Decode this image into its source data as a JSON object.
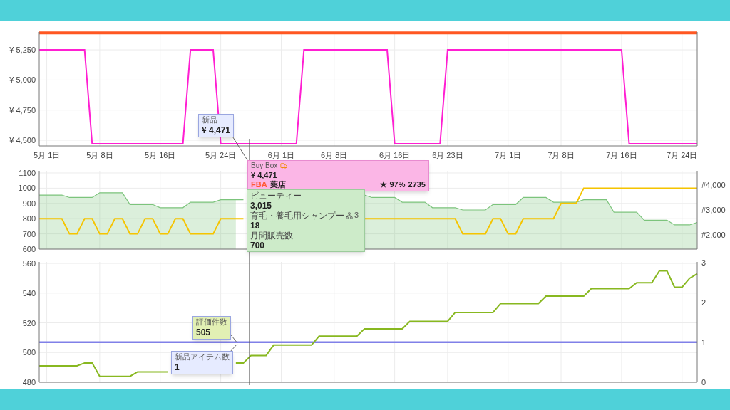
{
  "charts": [
    {
      "chart_data": {
        "type": "line",
        "grid": true,
        "ylim": [
          4453,
          5398
        ],
        "categories": [
          null,
          "5月 1日",
          null,
          null,
          null,
          null,
          null,
          null,
          "5月 8日",
          null,
          null,
          null,
          null,
          null,
          null,
          null,
          "5月 16日",
          null,
          null,
          null,
          null,
          null,
          null,
          null,
          "5月 24日",
          null,
          null,
          null,
          null,
          null,
          null,
          null,
          "6月 1日",
          null,
          null,
          null,
          null,
          null,
          null,
          "6月 8日",
          null,
          null,
          null,
          null,
          null,
          null,
          null,
          "6月 16日",
          null,
          null,
          null,
          null,
          null,
          null,
          "6月 23日",
          null,
          null,
          null,
          null,
          null,
          null,
          null,
          "7月 1日",
          null,
          null,
          null,
          null,
          null,
          null,
          "7月 8日",
          null,
          null,
          null,
          null,
          null,
          null,
          null,
          "7月 16日",
          null,
          null,
          null,
          null,
          null,
          null,
          null,
          "7月 24日",
          null,
          null
        ],
        "yticks": [
          {
            "value": 4500,
            "label": "¥ 4,500"
          },
          {
            "value": 4750,
            "label": "¥ 4,750"
          },
          {
            "value": 5000,
            "label": "¥ 5,000"
          },
          {
            "value": 5250,
            "label": "¥ 5,250"
          }
        ],
        "series": [
          {
            "color": "#ff5722",
            "values": [
              5390,
              5390,
              5390,
              5390,
              5390,
              5390,
              5390,
              5390,
              5390,
              5390,
              5390,
              5390,
              5390,
              5390,
              5390,
              5390,
              5390,
              5390,
              5390,
              5390,
              5390,
              5390,
              5390,
              5390,
              5390,
              5390,
              5390,
              5390,
              5390,
              5390,
              5390,
              5390,
              5390,
              5390,
              5390,
              5390,
              5390,
              5390,
              5390,
              5390,
              5390,
              5390,
              5390,
              5390,
              5390,
              5390,
              5390,
              5390,
              5390,
              5390,
              5390,
              5390,
              5390,
              5390,
              5390,
              5390,
              5390,
              5390,
              5390,
              5390,
              5390,
              5390,
              5390,
              5390,
              5390,
              5390,
              5390,
              5390,
              5390,
              5390,
              5390,
              5390,
              5390,
              5390,
              5390,
              5390,
              5390,
              5390,
              5390,
              5390,
              5390,
              5390,
              5390,
              5390,
              5390,
              5390,
              5390,
              5390
            ]
          },
          {
            "color": "#ff1fd2",
            "values": [
              5250,
              5250,
              5250,
              5250,
              5250,
              5250,
              5250,
              4471,
              4471,
              4471,
              4471,
              4471,
              4471,
              4471,
              4471,
              4471,
              4471,
              4471,
              4471,
              4471,
              5250,
              5250,
              5250,
              5250,
              4471,
              4471,
              4471,
              4471,
              4471,
              4471,
              4471,
              4471,
              4471,
              4471,
              4471,
              5250,
              5250,
              5250,
              5250,
              5250,
              5250,
              5250,
              5250,
              5250,
              5250,
              5250,
              5250,
              4471,
              4471,
              4471,
              4471,
              4471,
              4471,
              4471,
              5250,
              5250,
              5250,
              5250,
              5250,
              5250,
              5250,
              5250,
              5250,
              5250,
              5250,
              5250,
              5250,
              5250,
              5250,
              5250,
              5250,
              5250,
              5250,
              5250,
              5250,
              5250,
              5250,
              5250,
              4471,
              4471,
              4471,
              4471,
              4471,
              4471,
              4471,
              4471,
              4471,
              4471
            ]
          }
        ]
      },
      "tooltips": [
        {
          "kind": "simple",
          "title": "新品",
          "value": "¥ 4,471",
          "color": "#e6ebff"
        },
        {
          "kind": "buybox",
          "title": "Buy Box",
          "value": "¥ 4,471",
          "fulfillment": "FBA",
          "seller": "薬店",
          "rating": "★ 97%",
          "count": "2735",
          "color": "#fbb6e6"
        }
      ]
    },
    {
      "chart_data": {
        "type": "line",
        "grid": true,
        "ylim": [
          600,
          1114
        ],
        "categories": [
          null,
          null,
          null,
          null,
          null,
          null,
          null,
          null,
          null,
          null,
          null,
          null,
          null,
          null,
          null,
          null,
          null,
          null,
          null,
          null,
          null,
          null,
          null,
          null,
          null,
          null,
          null,
          null,
          null,
          null,
          null,
          null,
          null,
          null,
          null,
          null,
          null,
          null,
          null,
          null,
          null,
          null,
          null,
          null,
          null,
          null,
          null,
          null,
          null,
          null,
          null,
          null,
          null,
          null,
          null,
          null,
          null,
          null,
          null,
          null,
          null,
          null,
          null,
          null,
          null,
          null,
          null,
          null,
          null,
          null,
          null,
          null,
          null,
          null,
          null,
          null,
          null,
          null,
          null,
          null,
          null,
          null,
          null,
          null,
          null,
          null,
          null,
          null
        ],
        "yticks": [
          {
            "value": 600,
            "label": "600"
          },
          {
            "value": 700,
            "label": "700"
          },
          {
            "value": 800,
            "label": "800"
          },
          {
            "value": 900,
            "label": "900"
          },
          {
            "value": 1000,
            "label": "1000"
          },
          {
            "value": 1100,
            "label": "1100"
          }
        ],
        "series": [
          {
            "type": "area",
            "color": "#7cc47c",
            "values": [
              955,
              955,
              955,
              955,
              939,
              939,
              939,
              939,
              970,
              970,
              970,
              970,
              893,
              893,
              893,
              893,
              872,
              872,
              872,
              872,
              908,
              908,
              908,
              908,
              924,
              924,
              924,
              null,
              null,
              null,
              null,
              null,
              null,
              null,
              null,
              null,
              null,
              null,
              null,
              null,
              null,
              null,
              null,
              955,
              939,
              939,
              939,
              939,
              908,
              908,
              908,
              908,
              872,
              872,
              872,
              872,
              857,
              857,
              857,
              857,
              893,
              893,
              893,
              893,
              939,
              939,
              939,
              939,
              908,
              908,
              908,
              908,
              924,
              924,
              924,
              924,
              842,
              842,
              842,
              842,
              790,
              790,
              790,
              790,
              759,
              759,
              759,
              775
            ]
          },
          {
            "color": "#f5c400",
            "values": [
              800,
              800,
              800,
              800,
              700,
              700,
              800,
              800,
              700,
              700,
              800,
              800,
              700,
              700,
              800,
              800,
              700,
              700,
              800,
              800,
              700,
              700,
              700,
              700,
              800,
              800,
              800,
              null,
              null,
              null,
              null,
              null,
              null,
              null,
              null,
              null,
              null,
              null,
              null,
              null,
              null,
              null,
              null,
              800,
              800,
              800,
              800,
              800,
              800,
              800,
              800,
              800,
              800,
              800,
              800,
              800,
              700,
              700,
              700,
              700,
              800,
              800,
              700,
              700,
              800,
              800,
              800,
              800,
              800,
              900,
              900,
              900,
              1000,
              1000,
              1000,
              1000,
              1000,
              1000,
              1000,
              1000,
              1000,
              1000,
              1000,
              1000,
              1000,
              1000,
              1000,
              1000
            ]
          }
        ]
      },
      "right_axis_labels": [
        "#4,000",
        "#3,000",
        "#2,000"
      ],
      "tooltips": [
        {
          "kind": "rank",
          "color": "#cdebc9",
          "items": [
            {
              "label": "ビューティー",
              "value": "3,015"
            },
            {
              "label": "育毛・養毛用シャンプー",
              "value": "18",
              "badge": "3"
            },
            {
              "label": "月間販売数",
              "value": "700"
            }
          ]
        }
      ]
    },
    {
      "chart_data": {
        "type": "line",
        "grid": true,
        "ylim": [
          480,
          561
        ],
        "categories": [
          null,
          null,
          null,
          null,
          null,
          null,
          null,
          null,
          null,
          null,
          null,
          null,
          null,
          null,
          null,
          null,
          null,
          null,
          null,
          null,
          null,
          null,
          null,
          null,
          null,
          null,
          null,
          null,
          null,
          null,
          null,
          null,
          null,
          null,
          null,
          null,
          null,
          null,
          null,
          null,
          null,
          null,
          null,
          null,
          null,
          null,
          null,
          null,
          null,
          null,
          null,
          null,
          null,
          null,
          null,
          null,
          null,
          null,
          null,
          null,
          null,
          null,
          null,
          null,
          null,
          null,
          null,
          null,
          null,
          null,
          null,
          null,
          null,
          null,
          null,
          null,
          null,
          null,
          null,
          null,
          null,
          null,
          null,
          null,
          null,
          null,
          null,
          null
        ],
        "yticks": [
          {
            "value": 480,
            "label": "480"
          },
          {
            "value": 500,
            "label": "500"
          },
          {
            "value": 520,
            "label": "520"
          },
          {
            "value": 540,
            "label": "540"
          },
          {
            "value": 560,
            "label": "560"
          }
        ],
        "series": [
          {
            "color": "#8080e8",
            "values": [
              507,
              507,
              507,
              507,
              507,
              507,
              507,
              507,
              507,
              507,
              507,
              507,
              507,
              507,
              507,
              507,
              507,
              507,
              507,
              507,
              507,
              507,
              507,
              507,
              507,
              507,
              507,
              507,
              507,
              507,
              507,
              507,
              507,
              507,
              507,
              507,
              507,
              507,
              507,
              507,
              507,
              507,
              507,
              507,
              507,
              507,
              507,
              507,
              507,
              507,
              507,
              507,
              507,
              507,
              507,
              507,
              507,
              507,
              507,
              507,
              507,
              507,
              507,
              507,
              507,
              507,
              507,
              507,
              507,
              507,
              507,
              507,
              507,
              507,
              507,
              507,
              507,
              507,
              507,
              507,
              507,
              507,
              507,
              507,
              507,
              507,
              507,
              507
            ]
          },
          {
            "color": "#88b820",
            "values": [
              491,
              491,
              491,
              491,
              491,
              491,
              493,
              493,
              484,
              484,
              484,
              484,
              484,
              487,
              487,
              487,
              487,
              null,
              null,
              null,
              null,
              null,
              null,
              null,
              null,
              null,
              493,
              493,
              498,
              498,
              498,
              505,
              505,
              505,
              505,
              505,
              505,
              511,
              511,
              511,
              511,
              511,
              511,
              516,
              516,
              516,
              516,
              516,
              516,
              521,
              521,
              521,
              521,
              521,
              521,
              527,
              527,
              527,
              527,
              527,
              527,
              533,
              533,
              533,
              533,
              533,
              533,
              538,
              538,
              538,
              538,
              538,
              538,
              543,
              543,
              543,
              543,
              543,
              543,
              547,
              547,
              547,
              555,
              555,
              544,
              544,
              550,
              553
            ]
          }
        ]
      },
      "right_axis_labels": [
        "3",
        "2",
        "1",
        "0"
      ],
      "tooltips": [
        {
          "kind": "simple",
          "title": "評価件数",
          "value": "505",
          "color": "#e2f0b4"
        },
        {
          "kind": "simple",
          "title": "新品アイテム数",
          "value": "1",
          "color": "#e6ebff"
        }
      ]
    }
  ]
}
